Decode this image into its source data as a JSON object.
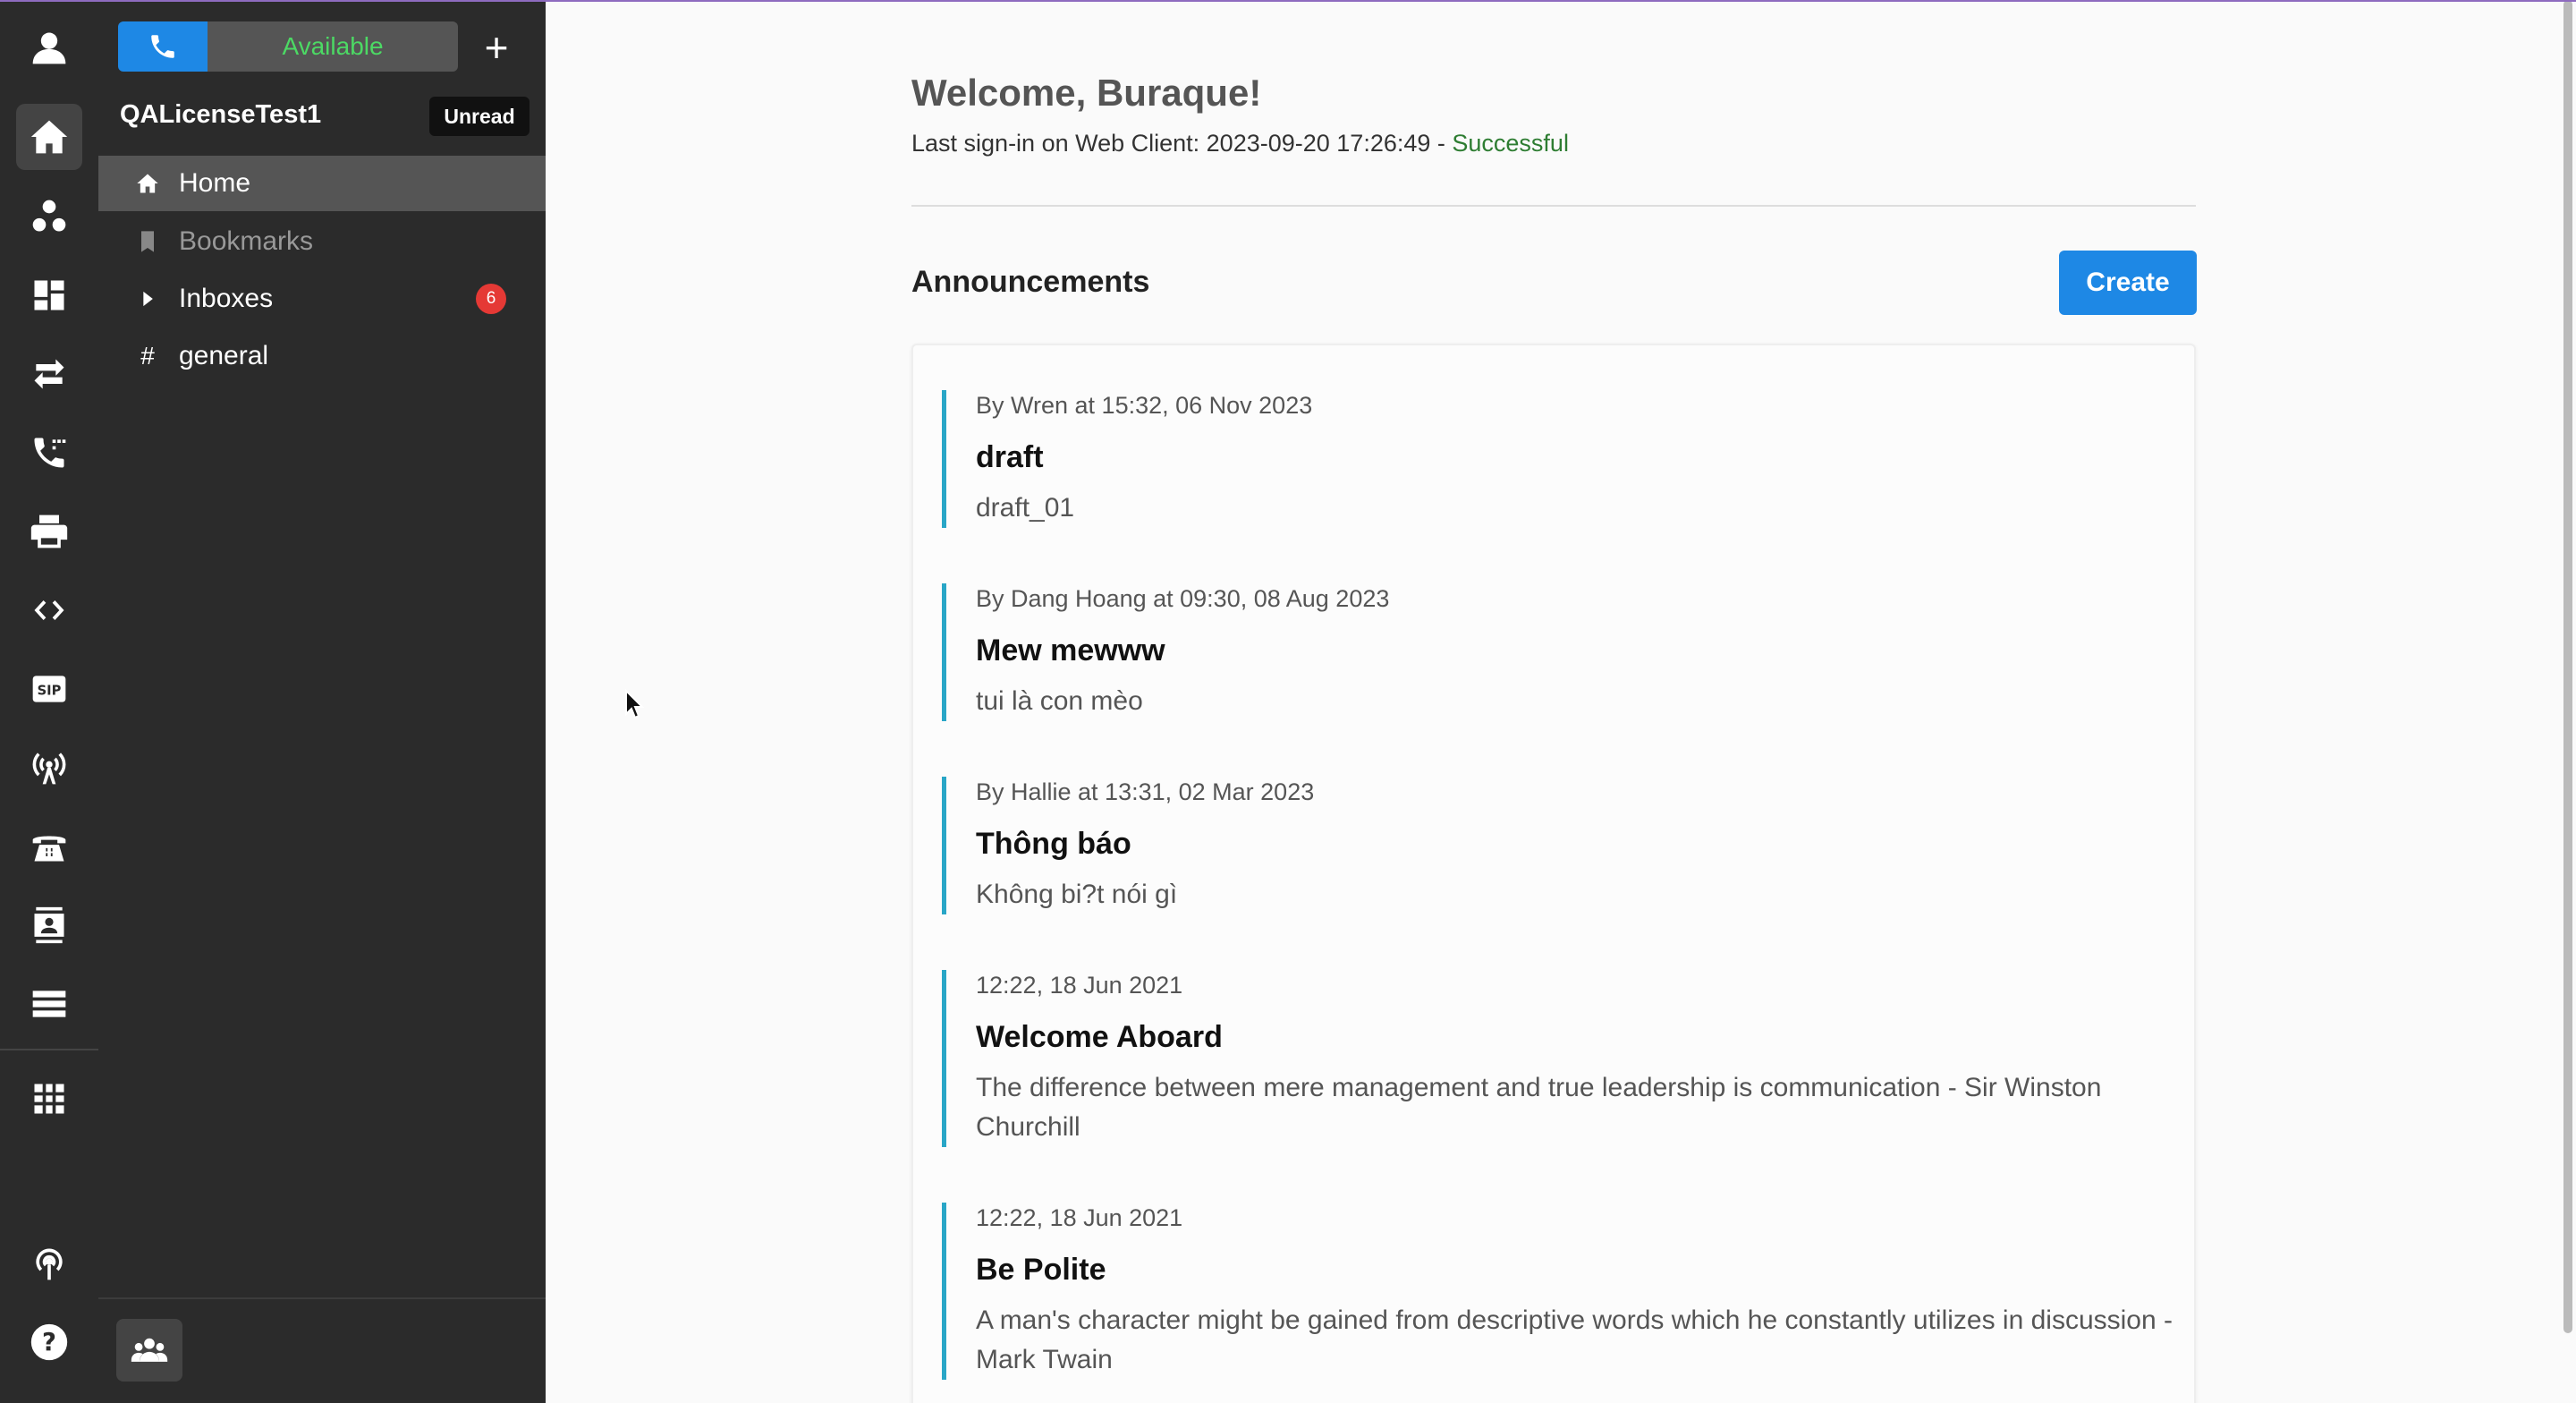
{
  "rail": {
    "items": [
      "profile",
      "home",
      "teams",
      "dashboard",
      "transfer",
      "call-log",
      "fax",
      "developer",
      "sip",
      "broadcast",
      "desk-phone",
      "contacts",
      "list",
      "apps",
      "podcast",
      "help"
    ]
  },
  "sidebar": {
    "status": "Available",
    "add_symbol": "+",
    "account_name": "QALicenseTest1",
    "unread_label": "Unread",
    "nav": [
      {
        "label": "Home",
        "icon": "home-icon",
        "active": true
      },
      {
        "label": "Bookmarks",
        "icon": "bookmark-icon"
      },
      {
        "label": "Inboxes",
        "icon": "caret-right-icon",
        "badge": "6"
      },
      {
        "label": "general",
        "icon": "hash-icon",
        "symbol": "#"
      }
    ]
  },
  "main": {
    "welcome": "Welcome, Buraque!",
    "last_signin_prefix": "Last sign-in on Web Client: 2023-09-20 17:26:49 - ",
    "last_signin_status": "Successful",
    "announcements_title": "Announcements",
    "create_label": "Create",
    "announcements": [
      {
        "meta": "By Wren at 15:32, 06 Nov 2023",
        "title": "draft",
        "body": "draft_01"
      },
      {
        "meta": "By Dang Hoang at 09:30, 08 Aug 2023",
        "title": "Mew mewww",
        "body": "tui là con mèo"
      },
      {
        "meta": "By Hallie at 13:31, 02 Mar 2023",
        "title": "Thông báo",
        "body": "Không bi?t nói gì"
      },
      {
        "meta": "12:22, 18 Jun 2021",
        "title": "Welcome Aboard",
        "body": "The difference between mere management and true leadership is communication - Sir Winston Churchill"
      },
      {
        "meta": "12:22, 18 Jun 2021",
        "title": "Be Polite",
        "body": "A man's character might be gained from descriptive words which he constantly utilizes in discussion - Mark Twain"
      }
    ]
  },
  "colors": {
    "accent": "#1e88e5",
    "status_green": "#4cd964",
    "success_text": "#2e7d32",
    "announcement_bar": "#29a6c7",
    "badge_red": "#e53935"
  }
}
